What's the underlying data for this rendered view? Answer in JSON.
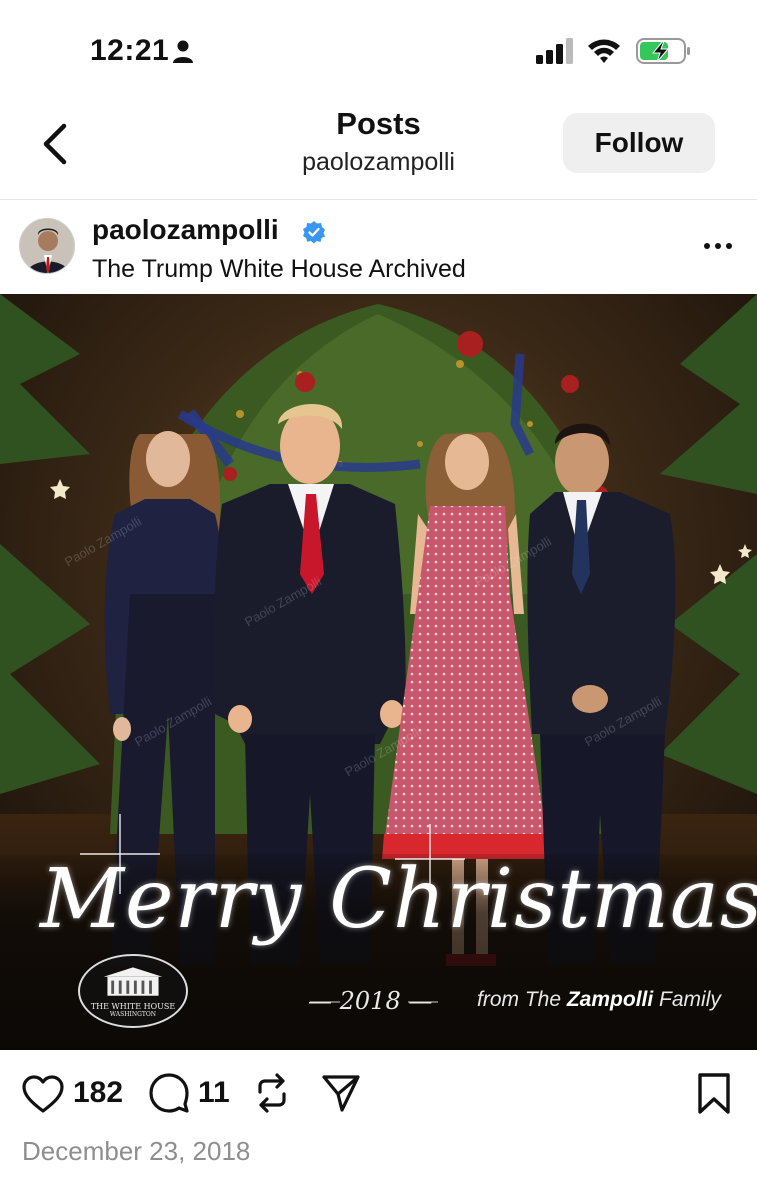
{
  "status_bar": {
    "time": "12:21",
    "icons": [
      "person-icon",
      "signal-icon",
      "wifi-icon",
      "battery-charging-icon"
    ]
  },
  "header": {
    "title": "Posts",
    "subtitle": "paolozampolli",
    "follow_label": "Follow",
    "back_icon": "chevron-left-icon"
  },
  "post": {
    "username": "paolozampolli",
    "verified": true,
    "location": "The Trump White House Archived",
    "more_icon": "ellipsis-icon",
    "image": {
      "greeting": "Merry Christmas!",
      "year": "— 2018 —",
      "from_prefix": "from The ",
      "from_name": "Zampolli",
      "from_suffix": " Family",
      "seal_text": "THE WHITE HOUSE",
      "seal_subtext": "WASHINGTON",
      "watermark": "Paolo Zampolli"
    },
    "likes": "182",
    "comments": "11",
    "date": "December 23, 2018"
  },
  "colors": {
    "follow_bg": "#efefef",
    "verified_blue": "#3897f0",
    "battery_green": "#34c759",
    "date_gray": "#8e8e8e"
  }
}
